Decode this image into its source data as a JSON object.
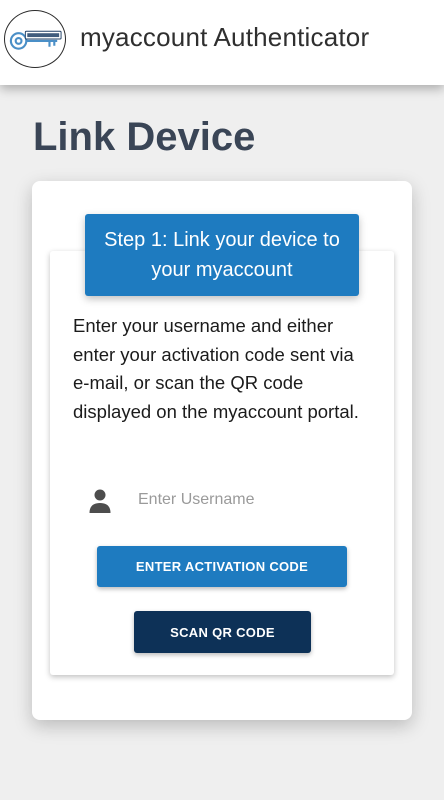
{
  "header": {
    "title": "myaccount Authenticator",
    "logo_icon": "key-logo-icon"
  },
  "page": {
    "title": "Link Device"
  },
  "step": {
    "banner": "Step 1: Link your device to your myaccount",
    "instructions": "Enter your username and either enter your activation code sent via e-mail, or scan the QR code displayed on the myaccount portal."
  },
  "form": {
    "username_placeholder": "Enter Username",
    "username_value": "",
    "user_icon": "person-icon"
  },
  "buttons": {
    "activation_label": "ENTER ACTIVATION CODE",
    "qr_label": "SCAN QR CODE"
  },
  "colors": {
    "primary": "#1e7bc0",
    "dark": "#0d3157",
    "title_text": "#3a4556",
    "background": "#efefef"
  }
}
